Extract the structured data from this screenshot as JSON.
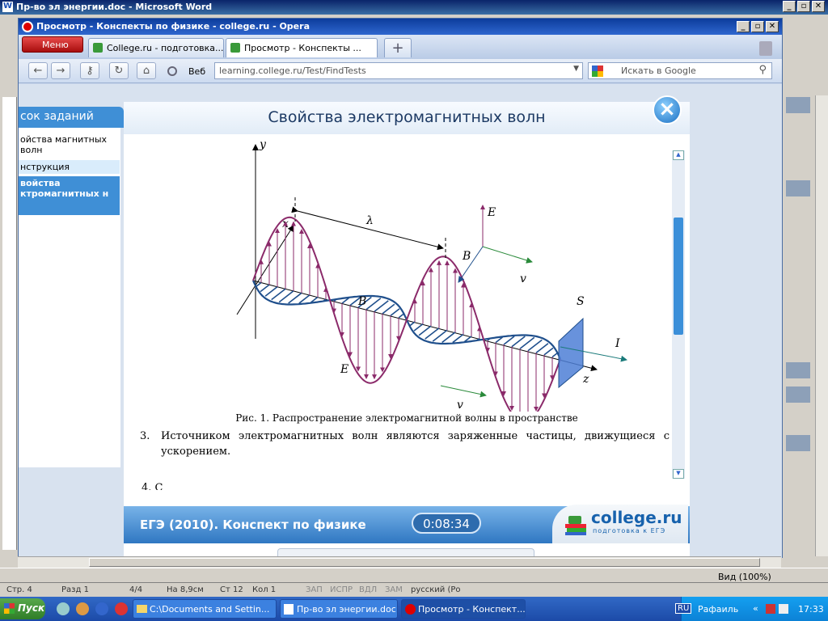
{
  "word": {
    "title": "Пр-во эл энергии.doc - Microsoft Word",
    "status": {
      "page": "Стр. 4",
      "section": "Разд 1",
      "pages": "4/4",
      "at": "На 8,9см",
      "line": "Ст 12",
      "col": "Кол 1",
      "rec": "ЗАП",
      "trk": "ИСПР",
      "ext": "ВДЛ",
      "ovr": "ЗАМ",
      "lang": "русский (Ро"
    }
  },
  "opera": {
    "title": "Просмотр - Конспекты по физике - college.ru - Opera",
    "menu": "Меню",
    "tabs": [
      "College.ru - подготовка...",
      "Просмотр - Конспекты ..."
    ],
    "web_label": "Веб",
    "url": "learning.college.ru/Test/FindTests",
    "search_placeholder": "Искать в Google",
    "zoom": "Вид (100%)"
  },
  "sidebar": {
    "header": "сок заданий",
    "items": [
      "ойства магнитных волн",
      "нструкция",
      "войства ктромагнитных н"
    ]
  },
  "dialog": {
    "title": "Свойства электромагнитных волн",
    "figure_labels": {
      "y": "y",
      "x": "x",
      "z": "z",
      "lambda": "λ",
      "E": "E",
      "B": "B",
      "v": "v",
      "S": "S",
      "I": "I"
    },
    "caption": "Рис. 1. Распространение электромагнитной волны в пространстве",
    "para_num": "3.",
    "para_text": "Источником электромагнитных волн являются заряженные частицы, движущиеся с ускорением.",
    "cut_text": "4.  С",
    "footer_title": "ЕГЭ (2010). Конспект по физике",
    "timer": "0:08:34",
    "logo": "college.ru",
    "logo_sub": "подготовка к ЕГЭ"
  },
  "taskbar": {
    "start": "Пуск",
    "tasks": [
      "C:\\Documents and Settin...",
      "Пр-во эл энергии.doc - ...",
      "Просмотр - Конспект..."
    ],
    "lang": "RU",
    "user": "Рафаиль",
    "clock": "17:33"
  }
}
